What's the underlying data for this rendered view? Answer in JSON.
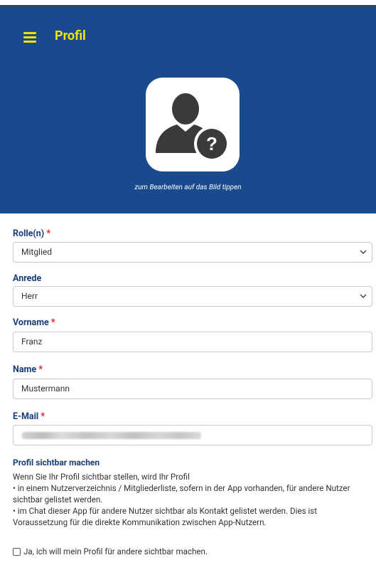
{
  "header": {
    "title": "Profil",
    "avatar_hint": "zum Bearbeiten auf das Bild tippen",
    "icons": {
      "menu": "hamburger-menu-icon",
      "avatar": "user-unknown-icon"
    },
    "colors": {
      "background": "#1a4a8e",
      "accent": "#f5e400"
    }
  },
  "form": {
    "role": {
      "label": "Rolle(n)",
      "required_mark": "*",
      "value": "Mitglied"
    },
    "salutation": {
      "label": "Anrede",
      "value": "Herr"
    },
    "first_name": {
      "label": "Vorname",
      "required_mark": "*",
      "value": "Franz"
    },
    "last_name": {
      "label": "Name",
      "required_mark": "*",
      "value": "Mustermann"
    },
    "email": {
      "label": "E-Mail",
      "required_mark": "*",
      "value": ""
    }
  },
  "visibility": {
    "title": "Profil sichtbar machen",
    "intro": "Wenn Sie Ihr Profil sichtbar stellen, wird Ihr Profil",
    "bullet1": "•  in einem Nutzerverzeichnis / Mitgliederliste, sofern in der App vorhanden, für andere Nutzer sichtbar gelistet werden.",
    "bullet2": "•  im Chat dieser App für andere Nutzer sichtbar als Kontakt gelistet werden. Dies ist Voraussetzung für die direkte Kommunikation zwischen App-Nutzern.",
    "checkbox_label": "Ja, ich will mein Profil für andere sichtbar machen.",
    "checked": false
  }
}
